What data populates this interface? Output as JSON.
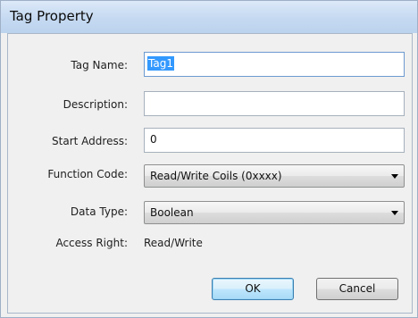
{
  "window": {
    "title": "Tag Property"
  },
  "form": {
    "tag_name": {
      "label": "Tag Name:",
      "value": "Tag1"
    },
    "description": {
      "label": "Description:",
      "value": ""
    },
    "start_address": {
      "label": "Start Address:",
      "value": "0"
    },
    "function_code": {
      "label": "Function Code:",
      "selected": "Read/Write Coils (0xxxx)"
    },
    "data_type": {
      "label": "Data Type:",
      "selected": "Boolean"
    },
    "access_right": {
      "label": "Access Right:",
      "value": "Read/Write"
    }
  },
  "buttons": {
    "ok": "OK",
    "cancel": "Cancel"
  },
  "icons": {
    "dropdown": "chevron-down-icon"
  }
}
